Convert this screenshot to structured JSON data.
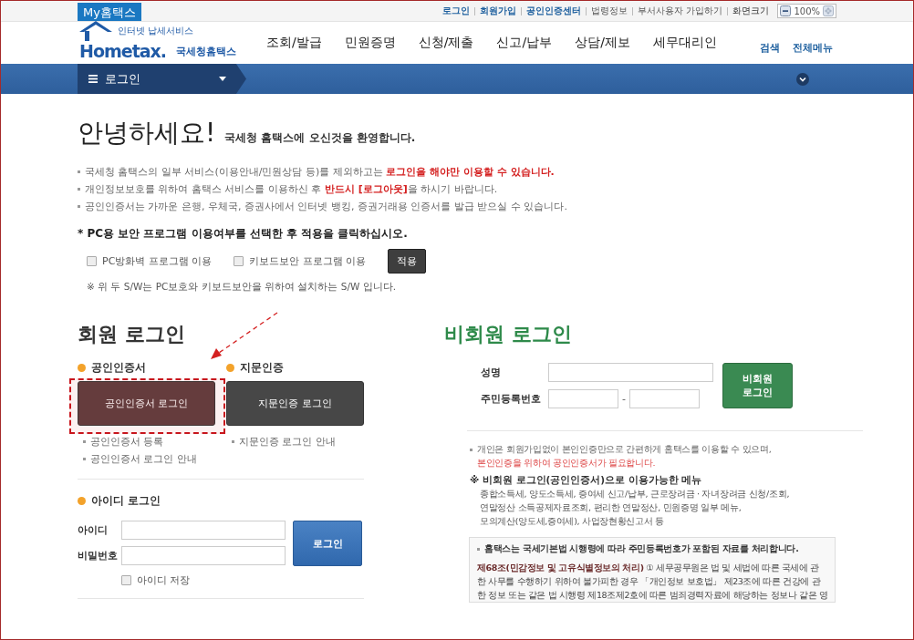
{
  "top_bar": {
    "my_tab": "My홈택스",
    "links": [
      {
        "label": "로그인",
        "kind": "highlight"
      },
      {
        "label": "회원가입",
        "kind": "highlight"
      },
      {
        "label": "공인인증센터",
        "kind": "highlight"
      },
      {
        "label": "법령정보",
        "kind": "plain"
      },
      {
        "label": "부서사용자 가입하기",
        "kind": "plain"
      },
      {
        "label": "화면크기",
        "kind": "label"
      }
    ],
    "zoom_value": "100%"
  },
  "header": {
    "logo_tagline": "인터넷 납세서비스",
    "logo_word": "Hometax.",
    "logo_name": "국세청홈택스",
    "menu": [
      "조회/발급",
      "민원증명",
      "신청/제출",
      "신고/납부",
      "상담/제보",
      "세무대리인"
    ],
    "utility_links": [
      "검색",
      "전체메뉴"
    ]
  },
  "location_bar": {
    "current": "로그인"
  },
  "greeting": {
    "title": "안녕하세요!",
    "subtitle": "국세청 홈택스에 오신것을 환영합니다."
  },
  "notices": [
    "국세청 홈택스의 일부 서비스(이용안내/민원상담 등)를 제외하고는 **로그인을 해야만 이용할 수 있습니다.**",
    "개인정보보호를 위하여 홈택스 서비스를 이용하신 후 **반드시 [로그아웃]**을 하시기 바랍니다.",
    "공인인증서는 가까운 은행, 우체국, 증권사에서 인터넷 뱅킹, 증권거래용 인증서를 발급 받으실 수 있습니다."
  ],
  "security": {
    "prompt": "* PC용 보안 프로그램 이용여부를 선택한 후 적용을 클릭하십시오.",
    "options": [
      {
        "label": "PC방화벽 프로그램 이용",
        "checked": false
      },
      {
        "label": "키보드보안 프로그램 이용",
        "checked": false
      }
    ],
    "apply_button": "적용",
    "note": "※ 위 두 S/W는 PC보호와 키보드보안을 위하여 설치하는 S/W 입니다."
  },
  "member_login": {
    "title": "회원 로그인",
    "methods": [
      {
        "heading": "공인인증서",
        "button": "공인인증서 로그인",
        "highlighted": true,
        "links": [
          "공인인증서 등록",
          "공인인증서 로그인 안내"
        ]
      },
      {
        "heading": "지문인증",
        "button": "지문인증 로그인",
        "highlighted": false,
        "links": [
          "지문인증 로그인 안내"
        ]
      }
    ],
    "id_login": {
      "heading": "아이디 로그인",
      "id_label": "아이디",
      "password_label": "비밀번호",
      "login_button": "로그인",
      "remember": {
        "label": "아이디 저장",
        "checked": false
      }
    }
  },
  "nonmember_login": {
    "title": "비회원 로그인",
    "name_label": "성명",
    "rrn_label": "주민등록번호",
    "rrn_separator": "-",
    "login_button": "비회원\n로그인",
    "notice": "개인은 회원가입없이 본인인증만으로 간편하게 홈택스를 이용할 수 있으며,",
    "notice_red": "본인인증을 위하여 공인인증서가 필요합니다.",
    "menu_heading": "※ 비회원 로그인(공인인증서)으로 이용가능한 메뉴",
    "menu_lines": [
      "종합소득세, 양도소득세, 증여세 신고/납부, 근로장려금 · 자녀장려금 신청/조회,",
      "연말정산 소득공제자료조회, 편리한 연말정산, 민원증명 일부 메뉴,",
      "모의계산(양도세,증여세), 사업장현황신고서 등"
    ],
    "privacy_box": {
      "heading": "홈택스는 국세기본법 시행령에 따라 주민등록번호가 포함된 자료를 처리합니다.",
      "body_lines": [
        "**제68조(민감정보 및 고유식별정보의 처리)** ① 세무공무원은 법 및 세법에 따른 국세에 관",
        "한 사무를 수행하기 위하여 불가피한 경우 「개인정보 보호법」 제23조에 따른 건강에 관",
        "한 정보 또는 같은 법 시행령 제18조제2호에 따른 범죄경력자료에 해당하는 정보나 같은 영"
      ]
    }
  }
}
